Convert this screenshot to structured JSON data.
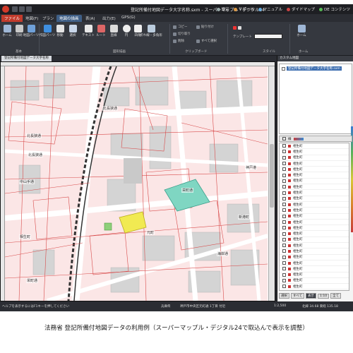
{
  "window": {
    "title": "登記所備付地図データ大字名称.sxm - スーパーマップル・デジタル24",
    "links": [
      "設定",
      "サポート",
      "マニュアル",
      "ダイドマップ",
      "DE コンテンツ"
    ]
  },
  "menu": {
    "tabs": [
      "ファイル",
      "地図(F)",
      "プラン",
      "地図の描画",
      "表(A)",
      "出力(E)",
      "GPS(G)"
    ],
    "active_index": 3
  },
  "ribbon": {
    "basic_group": {
      "label": "基本",
      "buttons": [
        "ホーム",
        "印刷",
        "地図パーツ"
      ]
    },
    "draw_group": {
      "label": "図形描画",
      "buttons": [
        "作図パーツ",
        "移動",
        "選択",
        "テキスト",
        "ルート",
        "直線",
        "円",
        "四角",
        "折れ線・多角形"
      ]
    },
    "clipboard_group": {
      "label": "クリップボード",
      "items": [
        "コピー",
        "切り取り",
        "削除",
        "貼り付け",
        "すべて選択"
      ]
    },
    "style_group": {
      "label": "スタイル",
      "template_label": "テンプレート",
      "template_value": ""
    },
    "home_group": {
      "label": "ホーム",
      "button": "ホーム"
    }
  },
  "document": {
    "tab": "登記所備付地図データ大字名称"
  },
  "map": {
    "labels": [
      "北長狭通",
      "北長狭通",
      "北長狭通",
      "中山手通",
      "栄町通",
      "相生町",
      "元町",
      "栄町通",
      "神戸港",
      "海岸通",
      "新港町"
    ]
  },
  "panel": {
    "title": "カスタム地図",
    "tree_item": "登記所備付地図データ大字名称.sxm",
    "legend_header": "線",
    "layers": [
      "相生町",
      "相生町",
      "相生町",
      "相生町",
      "相生町",
      "相生町",
      "相生町",
      "相生町",
      "相生町",
      "相生町",
      "相生町",
      "相生町",
      "相生町",
      "相生町",
      "相生町",
      "相生町",
      "相生町",
      "相生町",
      "相生町",
      "相生町",
      "相生町",
      "相生町",
      "相生町",
      "相生町",
      "相生町"
    ],
    "bottom_buttons": [
      "選択",
      "すべて",
      "表示",
      "1:10",
      "全て"
    ]
  },
  "status": {
    "left": "ヘルプを表示するにはF1キーを押してください",
    "middle1": "兵庫県",
    "middle2": "神戸市中央区元町通 1丁目 付近",
    "scale": "1:2,500",
    "coords": "北緯 34.68 東経 135.18"
  },
  "caption": "法務省 登記所備付地図データの利用例（スーパーマップル・デジタル24で取込んで表示を調整）"
}
